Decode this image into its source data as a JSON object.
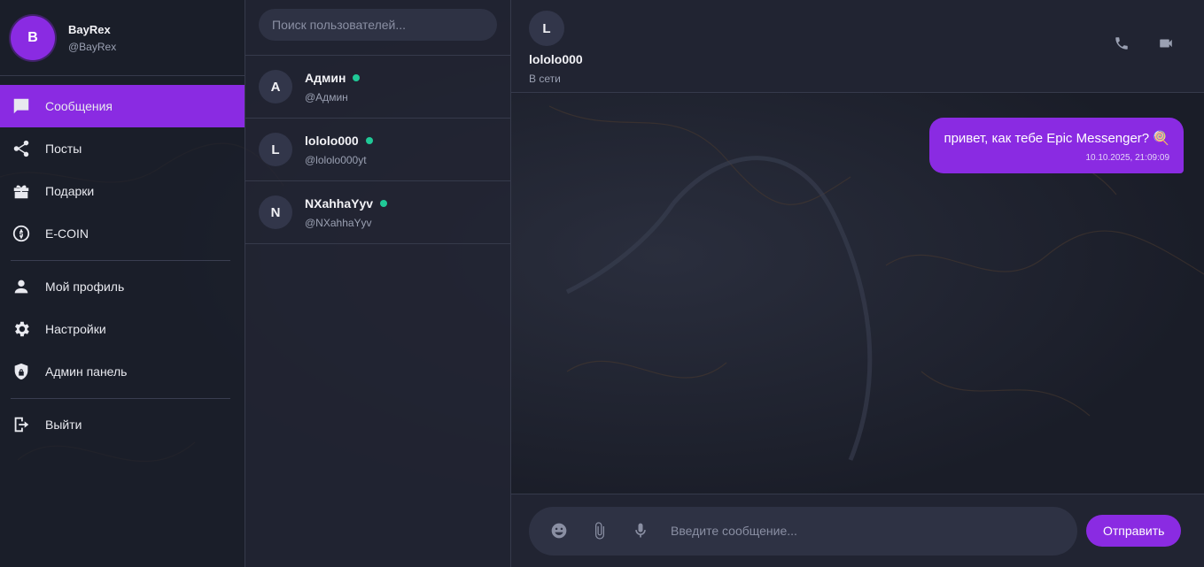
{
  "theme": {
    "accent": "#8a2be2",
    "online": "#20c997",
    "background": "#1c1f2b"
  },
  "profile": {
    "initial": "B",
    "name": "BayRex",
    "handle": "@BayRex"
  },
  "nav": {
    "messages": {
      "label": "Сообщения",
      "icon": "chat-icon"
    },
    "posts": {
      "label": "Посты",
      "icon": "share-icon"
    },
    "gifts": {
      "label": "Подарки",
      "icon": "gift-icon"
    },
    "ecoin": {
      "label": "E-COIN",
      "icon": "coin-icon"
    },
    "my_profile": {
      "label": "Мой профиль",
      "icon": "user-icon"
    },
    "settings": {
      "label": "Настройки",
      "icon": "gear-icon"
    },
    "admin": {
      "label": "Админ панель",
      "icon": "shield-icon"
    },
    "logout": {
      "label": "Выйти",
      "icon": "logout-icon"
    }
  },
  "search": {
    "placeholder": "Поиск пользователей..."
  },
  "contacts": [
    {
      "initial": "A",
      "name": "Админ",
      "handle": "@Админ",
      "online": true
    },
    {
      "initial": "L",
      "name": "lololo000",
      "handle": "@lololo000yt",
      "online": true
    },
    {
      "initial": "N",
      "name": "NXahhaYyv",
      "handle": "@NXahhaYyv",
      "online": true
    }
  ],
  "chat": {
    "initial": "L",
    "name": "lololo000",
    "status": "В сети",
    "messages": [
      {
        "text": "привет, как тебе Epic Messenger? 🍭",
        "time": "10.10.2025, 21:09:09",
        "outgoing": true
      }
    ]
  },
  "composer": {
    "placeholder": "Введите сообщение...",
    "send_label": "Отправить"
  }
}
